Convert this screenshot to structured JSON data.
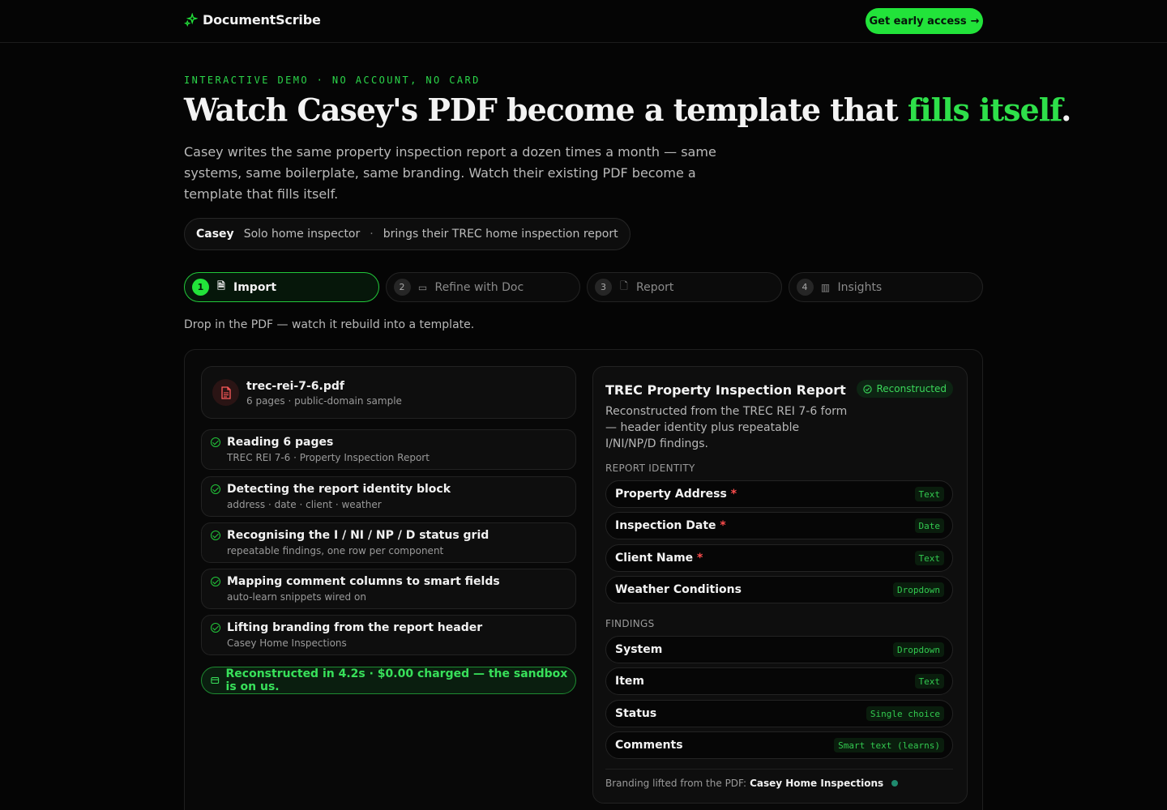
{
  "header": {
    "brand": "DocumentScribe",
    "brand_icon": "sparkle-icon",
    "cta_label": "Get early access",
    "cta_arrow": "→",
    "accent_color": "#22e33a"
  },
  "hero": {
    "eyebrow": "INTERACTIVE DEMO · NO ACCOUNT, NO CARD",
    "title_main": "Watch Casey's PDF become a template that ",
    "title_accent": "fills itself",
    "title_end": ".",
    "lead": "Casey writes the same property inspection report a dozen times a month — same systems, same boilerplate, same branding. Watch their existing PDF become a template that fills itself."
  },
  "persona": {
    "name": "Casey",
    "role": "Solo home inspector",
    "separator": "·",
    "brings": "brings their TREC home inspection report"
  },
  "steps": [
    {
      "num": "1",
      "label": "Import",
      "icon": "file-icon",
      "glyph": "🗎",
      "active": true
    },
    {
      "num": "2",
      "label": "Refine with Doc",
      "icon": "chat-icon",
      "glyph": "▭",
      "active": false
    },
    {
      "num": "3",
      "label": "Report",
      "icon": "file-icon",
      "glyph": "🗋",
      "active": false
    },
    {
      "num": "4",
      "label": "Insights",
      "icon": "bar-chart-icon",
      "glyph": "▥",
      "active": false
    }
  ],
  "caption": "Drop in the PDF — watch it rebuild into a template.",
  "file": {
    "name": "trec-rei-7-6.pdf",
    "meta": "6 pages · public-domain sample"
  },
  "tasks": [
    {
      "title": "Reading 6 pages",
      "sub": "TREC REI 7-6 · Property Inspection Report"
    },
    {
      "title": "Detecting the report identity block",
      "sub": "address · date · client · weather"
    },
    {
      "title": "Recognising the I / NI / NP / D status grid",
      "sub": "repeatable findings, one row per component"
    },
    {
      "title": "Mapping comment columns to smart fields",
      "sub": "auto-learn snippets wired on"
    },
    {
      "title": "Lifting branding from the report header",
      "sub": "Casey Home Inspections"
    }
  ],
  "success": "Reconstructed in 4.2s · $0.00 charged — the sandbox is on us.",
  "template": {
    "title": "TREC Property Inspection Report",
    "badge": "Reconstructed",
    "description": "Reconstructed from the TREC REI 7-6 form — header identity plus repeatable I/NI/NP/D findings.",
    "identity_label": "REPORT IDENTITY",
    "identity_fields": [
      {
        "name": "Property Address",
        "required": true,
        "type": "Text"
      },
      {
        "name": "Inspection Date",
        "required": true,
        "type": "Date"
      },
      {
        "name": "Client Name",
        "required": true,
        "type": "Text"
      },
      {
        "name": "Weather Conditions",
        "required": false,
        "type": "Dropdown"
      }
    ],
    "findings_label": "FINDINGS",
    "findings_fields": [
      {
        "name": "System",
        "required": false,
        "type": "Dropdown"
      },
      {
        "name": "Item",
        "required": false,
        "type": "Text"
      },
      {
        "name": "Status",
        "required": false,
        "type": "Single choice"
      },
      {
        "name": "Comments",
        "required": false,
        "type": "Smart text (learns)"
      }
    ],
    "branding_prefix": "Branding lifted from the PDF:",
    "branding_name": "Casey Home Inspections",
    "branding_color": "#1f8a6e"
  }
}
